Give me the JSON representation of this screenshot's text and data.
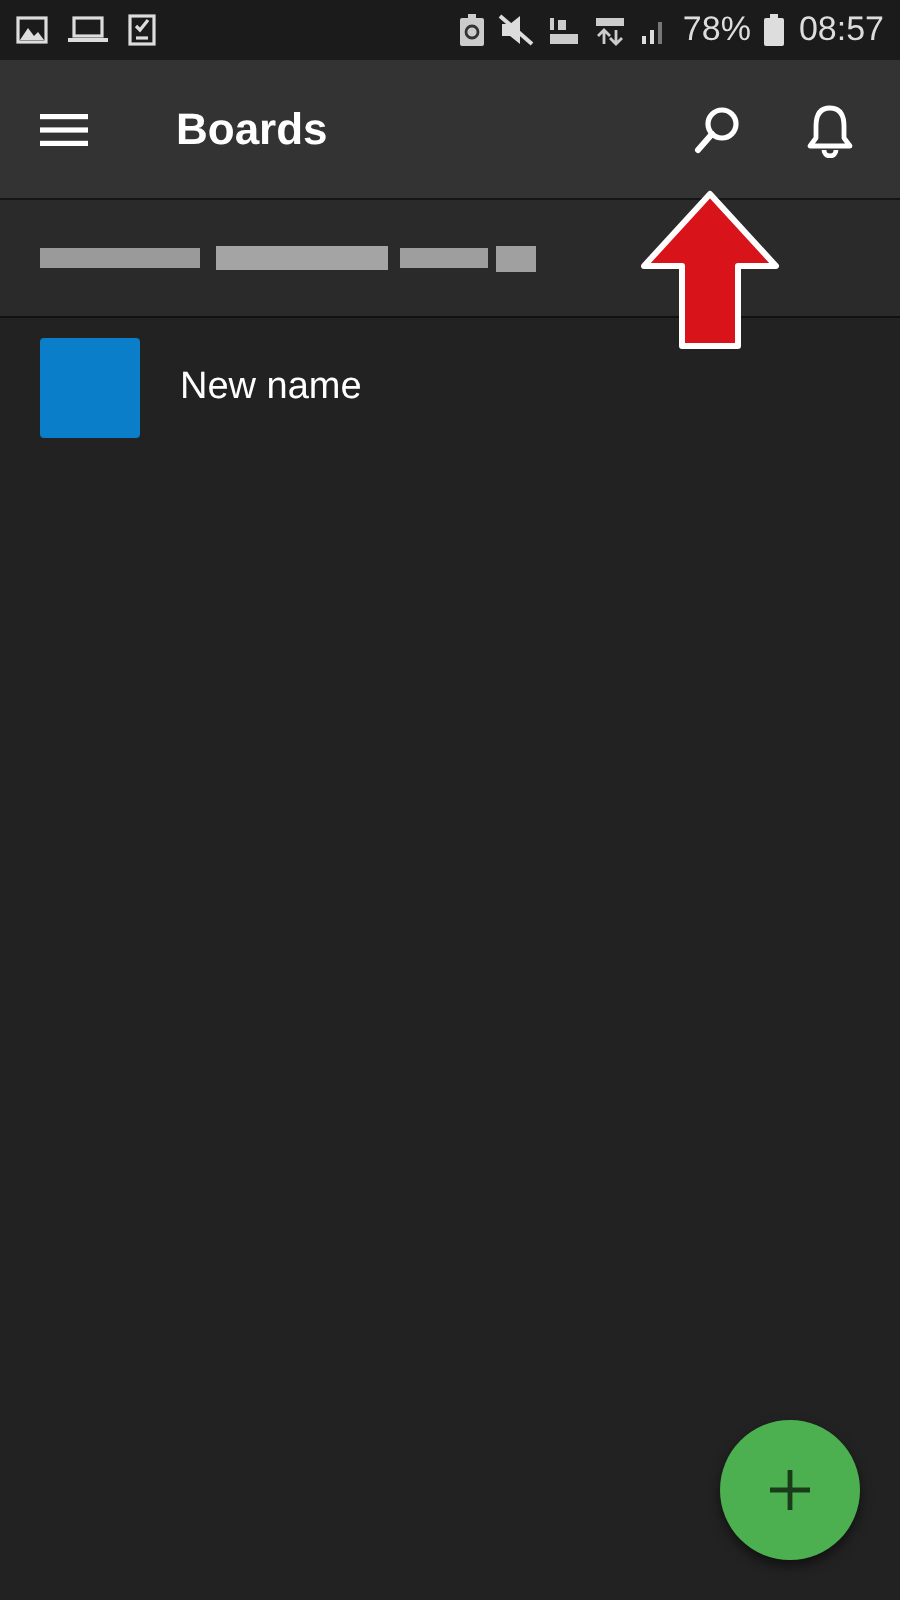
{
  "status_bar": {
    "battery": "78%",
    "time": "08:57"
  },
  "app_bar": {
    "title": "Boards"
  },
  "section": {
    "kind": "blurred"
  },
  "boards": [
    {
      "name": "New name",
      "color": "#0a7ec8"
    }
  ]
}
